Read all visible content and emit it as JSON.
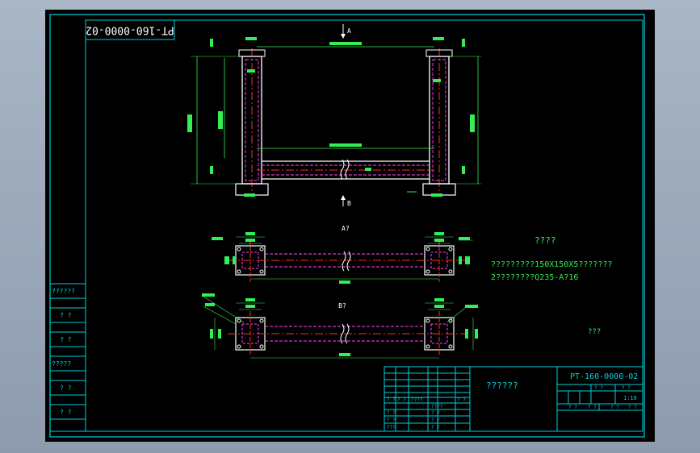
{
  "drawing": {
    "code_stamp_rotated": "PT-160-0000-02",
    "view_a_arrow_label": "A",
    "view_b_arrow_label": "B",
    "view_a_title": "A?",
    "view_b_title": "B?",
    "notes_title": "????",
    "note_1": "?????????150X150X5???????",
    "note_2": "2????????Q235-A?16",
    "note_3": "???"
  },
  "left_sidebar": {
    "labels": [
      "??????",
      "? ?",
      "? ?",
      "?????",
      "? ?",
      "? ?"
    ]
  },
  "title_block": {
    "drawing_name": "??????",
    "drawing_code": "PT-160-0000-02",
    "scale_headers": [
      "? ?",
      "? ?"
    ],
    "scale_value": "1:16",
    "sign_row": [
      "? ?",
      "? ?",
      "? ?",
      "? ?"
    ],
    "left_cells": [
      [
        "? ?",
        "? ?",
        "????",
        "????",
        "? ?"
      ],
      [
        "? ?",
        "? ?"
      ],
      [
        "? ?",
        "? ?"
      ],
      [
        "???",
        "? ?"
      ]
    ]
  },
  "colors": {
    "frame": "#00d0d8",
    "dimension": "#33ee55",
    "centerline": "#ff2a2a",
    "hidden": "#ff44ff",
    "outline": "#ffffff"
  }
}
